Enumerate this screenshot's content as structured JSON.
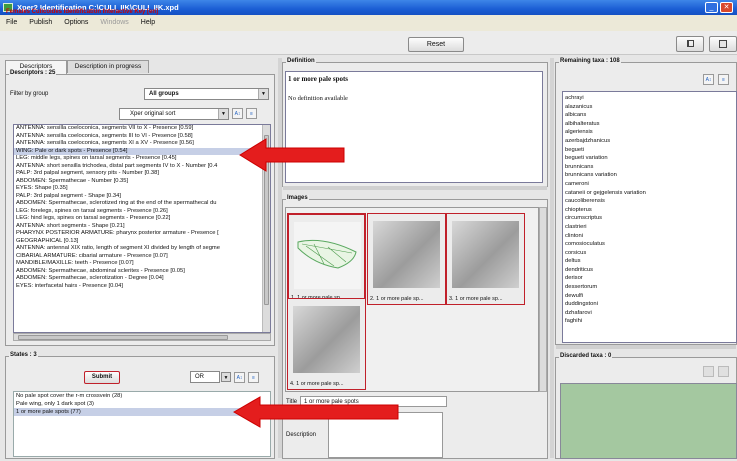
{
  "window": {
    "title": "Xper2 Identification    C:\\CULI_IIK\\CULI_IIK.xpd"
  },
  "menu": {
    "file": "File",
    "publish": "Publish",
    "options": "Options",
    "windows": "Windows",
    "help": "Help"
  },
  "toolbar": {
    "app_title": "Females Culicoides Identification Interactive Key [en]",
    "reset_label": "Reset"
  },
  "tabs": {
    "descriptors": "Descriptors",
    "in_progress": "Description in progress"
  },
  "descriptors": {
    "legend": "Descriptors : 25",
    "filter_label": "Filter by group",
    "filter_value": "All groups",
    "sort_value": "Xper original sort",
    "items": [
      "ANTENNA: sensilla coeloconica, segments VII to X - Presence [0.59]",
      "ANTENNA: sensilla coeloconica, segments III to VI - Presence [0.58]",
      "ANTENNA: sensilla coeloconica, segments XI a XV - Presence [0.56]",
      "WING: Pale or dark spots - Presence [0.54]",
      "LEG: middle legs, spines on tarsal segments - Presence [0.45]",
      "ANTENNA: short sensilla trichodea, distal part segments IV to X - Number [0.4",
      "PALP: 3rd palpal segment, sensory pits - Number [0.38]",
      "ABDOMEN: Spermathecae - Number [0.35]",
      "EYES: Shape [0.35]",
      "PALP: 3rd palpal segment - Shape [0.34]",
      "ABDOMEN: Spermathecae, sclerotized ring at the end of the spermathecal du",
      "LEG: forelegs, spines on tarsal segments - Presence [0.26]",
      "LEG: hind legs, spines on tarsal segments - Presence [0.22]",
      "ANTENNA: short segments - Shape [0.21]",
      "PHARYNX POSTERIOR ARMATURE: pharynx posterior armature - Presence [",
      "GEOGRAPHICAL [0.13]",
      "ANTENNA: antennal XIX ratio, length of segment XI divided by length of segme",
      "CIBARIAL ARMATURE: cibarial armature - Presence [0.07]",
      "MANDIBLE/MAXILLE: teeth - Presence [0.07]",
      "ABDOMEN: Spermathecae, abdominal sclerites - Presence [0.05]",
      "ABDOMEN: Spermathecae, sclerotization - Degree [0.04]",
      "EYES: interfacetal hairs - Presence [0.04]"
    ],
    "selected_index": 3
  },
  "states": {
    "legend": "States : 3",
    "submit_label": "Submit",
    "operator": "OR",
    "items": [
      "No pale spot cover the r-m crossvein (28)",
      "Pale wing, only 1 dark spot (3)",
      "1 or more pale spots (77)"
    ],
    "selected_index": 2
  },
  "definition": {
    "legend": "Definition",
    "heading": "1 or more pale spots",
    "body": "No definition available"
  },
  "images": {
    "legend": "Images",
    "captions": [
      "1. 1 or more pale sp...",
      "2. 1 or more pale sp...",
      "3. 1 or more pale sp...",
      "4. 1 or more pale sp..."
    ],
    "title_label": "Title",
    "title_value": "1 or more pale spots",
    "description_label": "Description"
  },
  "remaining": {
    "legend": "Remaining taxa : 108",
    "items": [
      "achrayi",
      "alazanicus",
      "albicans",
      "albihalteratus",
      "algeriensis",
      "azerbajdzhanicus",
      "begueti",
      "begueti variation",
      "brunnicans",
      "brunnicans variation",
      "cameroni",
      "cataneii or gejgelensis variation",
      "caucoliberensis",
      "chiopterus",
      "circumscriptus",
      "clastrieri",
      "clintoni",
      "comosioculatus",
      "corsicus",
      "deltus",
      "dendriticus",
      "derisor",
      "dessertorum",
      "dewulfi",
      "duddingstoni",
      "dzhafarovi",
      "faghihi"
    ]
  },
  "discarded": {
    "legend": "Discarded taxa : 0"
  }
}
